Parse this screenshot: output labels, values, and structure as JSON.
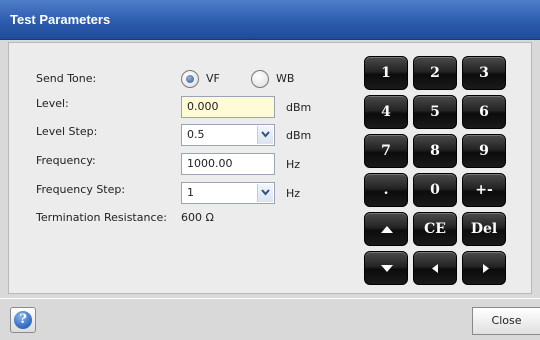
{
  "window": {
    "title": "Test Parameters"
  },
  "form": {
    "send_tone": {
      "label": "Send Tone:",
      "options": [
        {
          "label": "VF",
          "selected": true
        },
        {
          "label": "WB",
          "selected": false
        }
      ]
    },
    "level": {
      "label": "Level:",
      "value": "0.000",
      "unit": "dBm"
    },
    "level_step": {
      "label": "Level Step:",
      "value": "0.5",
      "unit": "dBm"
    },
    "frequency": {
      "label": "Frequency:",
      "value": "1000.00",
      "unit": "Hz"
    },
    "frequency_step": {
      "label": "Frequency Step:",
      "value": "1",
      "unit": "Hz"
    },
    "termination_resistance": {
      "label": "Termination Resistance:",
      "value": "600 Ω"
    }
  },
  "keypad": {
    "keys": [
      "1",
      "2",
      "3",
      "4",
      "5",
      "6",
      "7",
      "8",
      "9",
      ".",
      "0",
      "+-",
      "up-arrow-icon",
      "CE",
      "Del",
      "down-arrow-icon",
      "left-arrow-icon",
      "right-arrow-icon"
    ]
  },
  "keypad_labels": {
    "k1": "1",
    "k2": "2",
    "k3": "3",
    "k4": "4",
    "k5": "5",
    "k6": "6",
    "k7": "7",
    "k8": "8",
    "k9": "9",
    "kdot": ".",
    "k0": "0",
    "kplusminus": "+-",
    "kce": "CE",
    "kdel": "Del"
  },
  "footer": {
    "help_icon": "?",
    "close_label": "Close"
  },
  "colors": {
    "title_bar": "#2f5fb0",
    "focused_field": "#fffbd6",
    "keypad_key": "#1a1a1a"
  }
}
